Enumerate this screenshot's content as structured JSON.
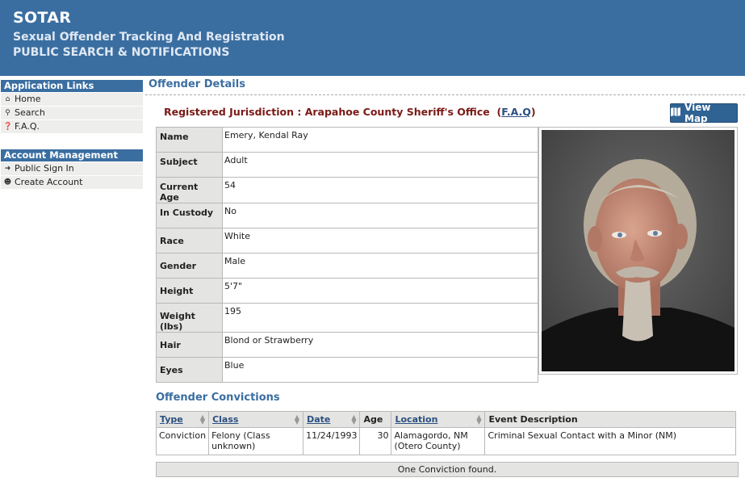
{
  "header": {
    "title": "SOTAR",
    "subtitle": "Sexual Offender Tracking And Registration",
    "subtitle2": "PUBLIC SEARCH & NOTIFICATIONS"
  },
  "sidebar": {
    "app_links_heading": "Application Links",
    "app_links": [
      {
        "label": "Home",
        "icon": "home-icon"
      },
      {
        "label": "Search",
        "icon": "search-icon"
      },
      {
        "label": "F.A.Q.",
        "icon": "question-icon"
      }
    ],
    "account_heading": "Account Management",
    "account_links": [
      {
        "label": "Public Sign In",
        "icon": "sign-in-icon"
      },
      {
        "label": "Create Account",
        "icon": "add-user-icon"
      }
    ]
  },
  "main": {
    "section_title": "Offender Details",
    "jurisdiction_text": "Registered Jurisdiction : Arapahoe County Sheriff's Office",
    "faq_open": "(",
    "faq_link": "F.A.Q",
    "faq_close": ")",
    "view_map_label": "View Map",
    "details": [
      {
        "label": "Name",
        "value": "Emery, Kendal Ray"
      },
      {
        "label": "Subject",
        "value": "Adult"
      },
      {
        "label": "Current Age",
        "value": "54"
      },
      {
        "label": "In Custody",
        "value": "No"
      },
      {
        "label": "Race",
        "value": "White"
      },
      {
        "label": "Gender",
        "value": "Male"
      },
      {
        "label": "Height",
        "value": "5'7\""
      },
      {
        "label": "Weight (lbs)",
        "value": "195"
      },
      {
        "label": "Hair",
        "value": "Blond or Strawberry"
      },
      {
        "label": "Eyes",
        "value": "Blue"
      }
    ]
  },
  "convictions": {
    "title": "Offender Convictions",
    "headers": {
      "type": "Type",
      "class": "Class",
      "date": "Date",
      "age": "Age",
      "location": "Location",
      "description": "Event Description"
    },
    "rows": [
      {
        "type": "Conviction",
        "class_line1": "Felony (Class",
        "class_line2": "unknown)",
        "date": "11/24/1993",
        "age": "30",
        "location_line1": "Alamagordo, NM",
        "location_line2": "(Otero County)",
        "description": "Criminal Sexual Contact with a Minor (NM)"
      }
    ],
    "footer": "One Conviction found."
  },
  "colors": {
    "header_blue": "#3a6ea1",
    "jurisdiction_red": "#7a1a16",
    "label_gray": "#e4e4e2"
  }
}
